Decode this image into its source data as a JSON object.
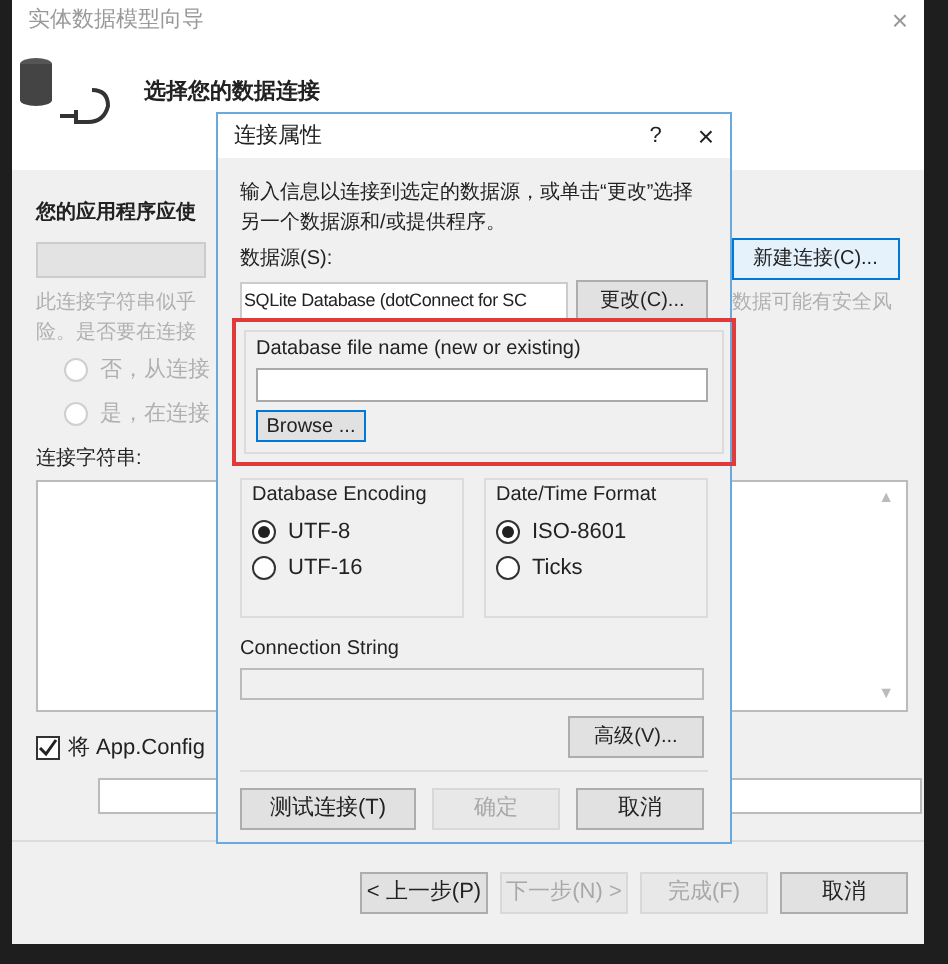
{
  "wizard": {
    "title": "实体数据模型向导",
    "close": "×",
    "scroll_up": "▲",
    "scroll_down": "▼",
    "header": "选择您的数据连接",
    "question": "您的应用程序应使",
    "new_connection_button": "新建连接(C)...",
    "warning_left": [
      "此连接字符串似乎",
      "险。是否要在连接"
    ],
    "warning_right": "数据可能有安全风",
    "options": [
      {
        "label": "否，从连接",
        "selected": false
      },
      {
        "label": "是，在连接",
        "selected": false
      }
    ],
    "connection_string_label": "连接字符串:",
    "save_checkbox": {
      "label": "将 App.Config",
      "checked": true
    },
    "buttons": [
      {
        "label": "< 上一步(P)",
        "disabled": false
      },
      {
        "label": "下一步(N) >",
        "disabled": true
      },
      {
        "label": "完成(F)",
        "disabled": true
      },
      {
        "label": "取消",
        "disabled": false
      }
    ]
  },
  "dialog": {
    "title": "连接属性",
    "help": "?",
    "close": "×",
    "intro": "输入信息以连接到选定的数据源，或单击“更改”选择另一个数据源和/或提供程序。",
    "datasource_label": "数据源(S):",
    "datasource_value": "SQLite Database (dotConnect for SC",
    "change_button": "更改(C)...",
    "file_group": {
      "title": "Database file name (new or existing)",
      "browse_button": "Browse ..."
    },
    "groups": [
      {
        "title": "Database Encoding",
        "options": [
          {
            "label": "UTF-8",
            "selected": true
          },
          {
            "label": "UTF-16",
            "selected": false
          }
        ]
      },
      {
        "title": "Date/Time Format",
        "options": [
          {
            "label": "ISO-8601",
            "selected": true
          },
          {
            "label": "Ticks",
            "selected": false
          }
        ]
      }
    ],
    "connection_string_label": "Connection String",
    "advanced_button": "高级(V)...",
    "buttons": [
      {
        "label": "测试连接(T)",
        "disabled": false
      },
      {
        "label": "确定",
        "disabled": true
      },
      {
        "label": "取消",
        "disabled": false
      }
    ]
  }
}
